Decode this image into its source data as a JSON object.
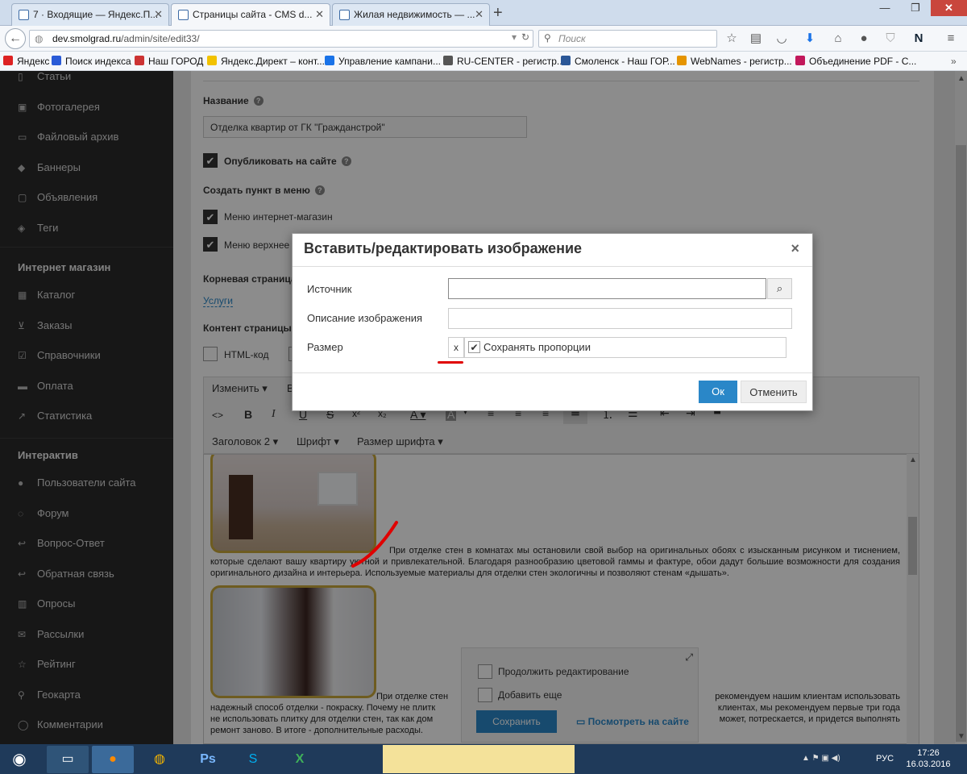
{
  "browser": {
    "tabs": [
      {
        "label": "7 · Входящие — Яндекс.П..."
      },
      {
        "label": "Страницы сайта - CMS d..."
      },
      {
        "label": "Жилая недвижимость — ..."
      }
    ],
    "url_domain": "dev.smolgrad.ru",
    "url_path": "/admin/site/edit33/",
    "search_placeholder": "Поиск",
    "bookmarks": [
      {
        "label": "Яндекс",
        "color": "#d22"
      },
      {
        "label": "Поиск индекса",
        "color": "#2a5bd7"
      },
      {
        "label": "Наш ГОРОД",
        "color": "#c33"
      },
      {
        "label": "Яндекс.Директ – конт...",
        "color": "#f2c200"
      },
      {
        "label": "Управление кампани...",
        "color": "#1a73e8"
      },
      {
        "label": "RU-CENTER - регистр...",
        "color": "#555"
      },
      {
        "label": "Смоленск - Наш ГОР...",
        "color": "#2b5797"
      },
      {
        "label": "WebNames - регистр...",
        "color": "#e59400"
      },
      {
        "label": "Объединение PDF - С...",
        "color": "#c2185b"
      }
    ]
  },
  "sidebar": {
    "items_top": [
      {
        "icon": "doc-icon",
        "label": "Статьи"
      },
      {
        "icon": "image-icon",
        "label": "Фотогалерея"
      },
      {
        "icon": "folder-icon",
        "label": "Файловый архив"
      },
      {
        "icon": "tag-icon",
        "label": "Баннеры"
      },
      {
        "icon": "board-icon",
        "label": "Объявления"
      },
      {
        "icon": "tags-icon",
        "label": "Теги"
      }
    ],
    "section_shop": "Интернет магазин",
    "items_shop": [
      {
        "icon": "grid-icon",
        "label": "Каталог"
      },
      {
        "icon": "cart-icon",
        "label": "Заказы"
      },
      {
        "icon": "check-icon",
        "label": "Справочники"
      },
      {
        "icon": "card-icon",
        "label": "Оплата"
      },
      {
        "icon": "chart-icon",
        "label": "Статистика"
      }
    ],
    "section_interactive": "Интерактив",
    "items_interactive": [
      {
        "icon": "users-icon",
        "label": "Пользователи сайта"
      },
      {
        "icon": "forum-icon",
        "label": "Форум"
      },
      {
        "icon": "reply-icon",
        "label": "Вопрос-Ответ"
      },
      {
        "icon": "reply-icon",
        "label": "Обратная связь"
      },
      {
        "icon": "bars-icon",
        "label": "Опросы"
      },
      {
        "icon": "mail-icon",
        "label": "Рассылки"
      },
      {
        "icon": "star-icon",
        "label": "Рейтинг"
      },
      {
        "icon": "pin-icon",
        "label": "Геокарта"
      },
      {
        "icon": "comment-icon",
        "label": "Комментарии"
      }
    ]
  },
  "form": {
    "name_label": "Название",
    "name_value": "Отделка квартир от ГК \"Гражданстрой\"",
    "publish_label": "Опубликовать на сайте",
    "menu_label": "Создать пункт в меню",
    "menu_shop_label": "Меню интернет-магазин",
    "menu_top_label": "Меню верхнее",
    "root_label": "Корневая страница",
    "root_value": "Услуги",
    "content_label": "Контент страницы",
    "html_code_label": "HTML-код"
  },
  "editor": {
    "menu_edit": "Изменить ▾",
    "menu_e": "В",
    "heading": "Заголовок 2 ▾",
    "font": "Шрифт ▾",
    "font_size": "Размер шрифта ▾",
    "para1": "При отделке стен в комнатах мы остановили свой выбор на оригинальных обоях с изысканным рисунком и тиснением, которые сделают вашу квартиру уютной и привлекательной. Благодаря разнообразию цветовой гаммы и фактуре, обои дадут большие возможности для создания оригинального дизайна и интерьера. Используемые материалы для отделки стен экологичны и позволяют стенам «дышать».",
    "para2_start": "При отделке стен",
    "para2_right": "рекомендуем нашим клиентам использовать",
    "para2_line2_left": "надежный способ отделки - покраску. Почему не плитк",
    "para2_line2_right": "клиентах, мы рекомендуем первые три года",
    "para2_line3_left": "не использовать плитку для отделки стен, так как дом",
    "para2_line3_right": "может, потрескается, и придется выполнять",
    "para2_line4": "ремонт заново. В итоге - дополнительные расходы."
  },
  "save_panel": {
    "continue_label": "Продолжить редактирование",
    "add_more_label": "Добавить еще",
    "save_button": "Сохранить",
    "view_link": "Посмотреть на сайте"
  },
  "modal": {
    "title": "Вставить/редактировать изображение",
    "close": "×",
    "source_label": "Источник",
    "source_value": "",
    "description_label": "Описание изображения",
    "description_value": "",
    "size_label": "Размер",
    "size_x": "x",
    "keep_proportions_label": "Сохранять пропорции",
    "ok_button": "Ок",
    "cancel_button": "Отменить"
  },
  "taskbar": {
    "lang": "РУС",
    "time": "17:26",
    "date": "16.03.2016"
  },
  "colors": {
    "accent": "#2a87c8",
    "annotation": "#e00000"
  }
}
